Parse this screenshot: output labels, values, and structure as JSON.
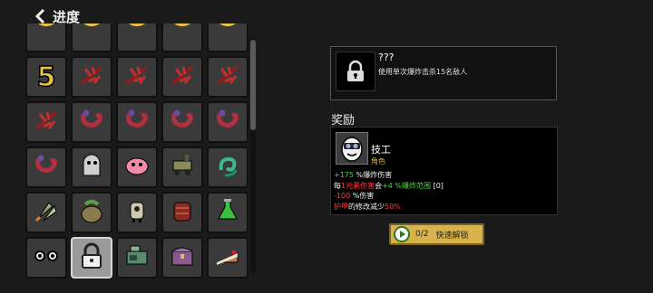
{
  "header": {
    "title": "进度"
  },
  "grid": {
    "rows": [
      [
        "partial-icon",
        "partial-icon",
        "partial-icon",
        "partial-icon",
        "partial-icon"
      ],
      [
        "number-five",
        "red-feather-icon",
        "red-feather-icon",
        "red-feather-icon",
        "red-feather-icon"
      ],
      [
        "red-feather-icon",
        "red-worm-icon",
        "red-worm-icon",
        "red-worm-icon",
        "red-worm-icon"
      ],
      [
        "red-worm-icon",
        "ghost-icon",
        "pink-blob-icon",
        "cart-icon",
        "green-swirl-icon"
      ],
      [
        "rocket-icon",
        "money-bag-icon",
        "robot-icon",
        "backpack-icon",
        "potion-icon"
      ],
      [
        "eyes-icon",
        "lock-icon",
        "machine-icon",
        "chest-icon",
        "cake-icon"
      ]
    ],
    "five_label": "5"
  },
  "achievement": {
    "title": "???",
    "description": "使用单次爆炸击杀15名敌人",
    "icon": "lock-icon"
  },
  "reward": {
    "heading": "奖励",
    "name": "技工",
    "type": "角色",
    "stats": [
      {
        "parts": [
          {
            "t": "+175",
            "c": "g"
          },
          {
            "t": " %爆炸伤害",
            "c": "w"
          }
        ]
      },
      {
        "parts": [
          {
            "t": "每",
            "c": "w"
          },
          {
            "t": "1元素伤害",
            "c": "r"
          },
          {
            "t": "会",
            "c": "w"
          },
          {
            "t": "+4 %爆炸范围",
            "c": "g"
          },
          {
            "t": " [0]",
            "c": "w"
          }
        ]
      },
      {
        "parts": [
          {
            "t": "-100",
            "c": "r"
          },
          {
            "t": " %伤害",
            "c": "w"
          }
        ]
      },
      {
        "parts": [
          {
            "t": "护甲",
            "c": "r"
          },
          {
            "t": "的修改减少",
            "c": "w"
          },
          {
            "t": "50%",
            "c": "r"
          }
        ]
      }
    ]
  },
  "unlock": {
    "count": "0/2",
    "label": "快速解锁"
  }
}
